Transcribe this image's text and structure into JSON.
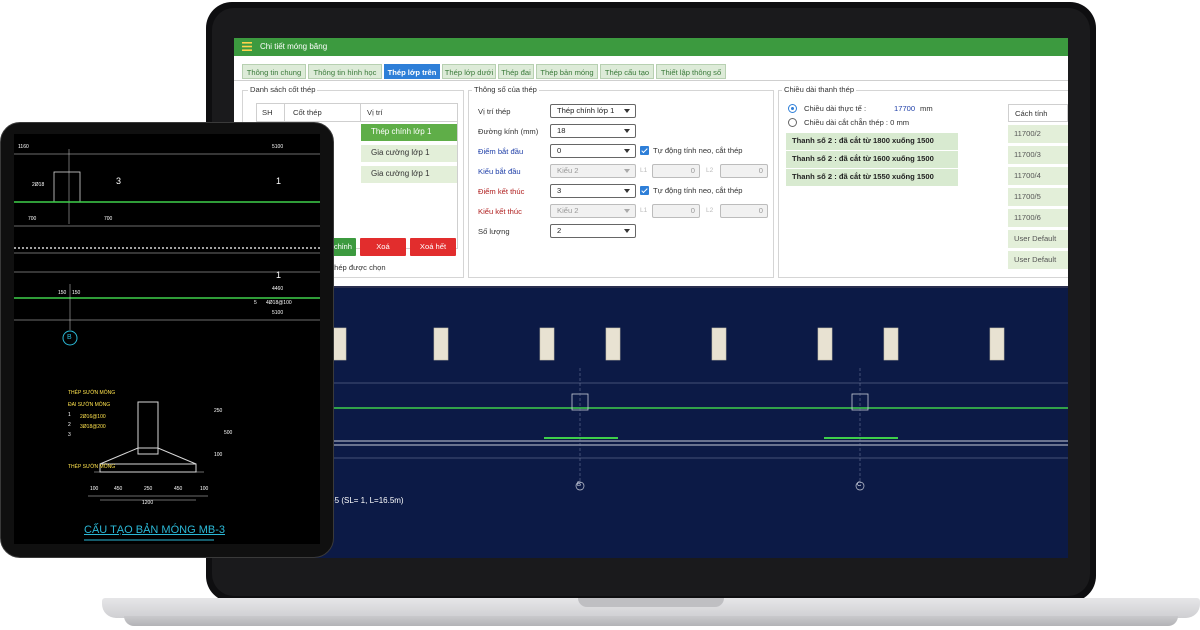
{
  "app": {
    "title": "Chi tiết móng băng",
    "tabs": [
      {
        "label": "Thông tin chung",
        "active": false
      },
      {
        "label": "Thông tin hình học",
        "active": false
      },
      {
        "label": "Thép lớp trên",
        "active": true
      },
      {
        "label": "Thép lớp dưới",
        "active": false
      },
      {
        "label": "Thép đai",
        "active": false
      },
      {
        "label": "Thép bản móng",
        "active": false
      },
      {
        "label": "Thép cấu tạo",
        "active": false
      },
      {
        "label": "Thiết lập thông số",
        "active": false
      }
    ],
    "steel_list": {
      "title": "Danh sách cốt thép",
      "columns": [
        "SH",
        "Cốt thép",
        "Vị trí"
      ],
      "rows": [
        {
          "position": "Thép chính lớp 1",
          "selected": true
        },
        {
          "position": "Gia cường lớp 1",
          "selected": false
        },
        {
          "position": "Gia cường lớp 1",
          "selected": false
        }
      ],
      "buttons": {
        "edit": "chỉnh",
        "delete": "Xoá",
        "delete_all": "Xoá hết"
      },
      "footer_note": "thép được chọn"
    },
    "params": {
      "title": "Thông số của thép",
      "position_label": "Vị trí thép",
      "position_value": "Thép chính lớp 1",
      "diameter_label": "Đường kính (mm)",
      "diameter_value": "18",
      "start_point_label": "Điểm bắt đầu",
      "start_point_value": "0",
      "start_type_label": "Kiểu bắt đầu",
      "start_type_value": "Kiểu 2",
      "end_point_label": "Điểm kết thúc",
      "end_point_value": "3",
      "end_type_label": "Kiểu kết thúc",
      "end_type_value": "Kiểu 2",
      "quantity_label": "Số lượng",
      "quantity_value": "2",
      "auto_label": "Tự động tính neo, cắt thép",
      "l1": "L1",
      "l2": "L2",
      "zero": "0"
    },
    "length": {
      "title": "Chiều dài thanh thép",
      "actual_label": "Chiều dài thực tế :",
      "actual_value": "17700",
      "actual_unit": "mm",
      "cut_label": "Chiều dài cắt chẵn thép : 0 mm",
      "summary": [
        "Thanh số 2 : đã cắt từ 1800 xuống 1500",
        "Thanh số 2 : đã cắt từ 1600 xuống 1500",
        "Thanh số 2 : đã cắt từ 1550 xuống 1500"
      ],
      "method_header": "Cách tính",
      "methods": [
        "11700/2",
        "11700/3",
        "11700/4",
        "11700/5",
        "11700/6",
        "User Default",
        "User Default"
      ]
    },
    "drawing": {
      "caption": "-5 (SL= 1, L=16.5m)",
      "axis_b": "B",
      "axis_c": "C"
    }
  },
  "tablet": {
    "dims_top": [
      "1160",
      "5100"
    ],
    "labels": [
      "2Ø18",
      "3",
      "1",
      "700",
      "700",
      "4460",
      "4Ø18@100",
      "5100",
      "150",
      "150",
      "5",
      "1"
    ],
    "axis": "B",
    "section_labels": [
      "THÉP SƯỜN MÓNG",
      "ĐAI SƯỜN MÓNG",
      "2Ø16@100",
      "3Ø18@200",
      "THÉP SƯỜN MÓNG"
    ],
    "section_numbers": [
      "1",
      "2",
      "3"
    ],
    "dims_bottom": [
      "100",
      "450",
      "250",
      "450",
      "100"
    ],
    "width_total": "1200",
    "side_dims": [
      "250",
      "500",
      "100"
    ],
    "title": "CẤU TẠO BẢN MÓNG MB-3"
  },
  "colors": {
    "accent_green": "#3c9a3f",
    "active_tab": "#2e7fd8",
    "danger_red": "#e22d2d",
    "cad_background": "#0c1a46"
  }
}
